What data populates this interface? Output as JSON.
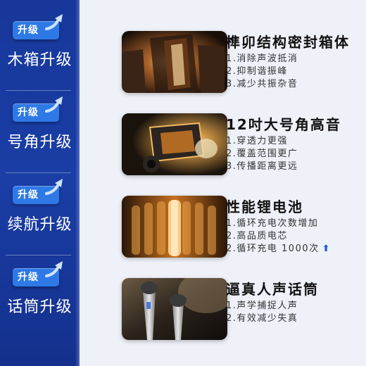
{
  "sidebar": {
    "items": [
      {
        "badge": "升级",
        "label": "木箱升级"
      },
      {
        "badge": "升级",
        "label": "号角升级"
      },
      {
        "badge": "升级",
        "label": "续航升级"
      },
      {
        "badge": "升级",
        "label": "话筒升级"
      }
    ]
  },
  "features": [
    {
      "title": "榫卯结构密封箱体",
      "points": [
        "1.消除声波抵消",
        "2.抑制谐振峰",
        "3.减少共振杂音"
      ]
    },
    {
      "title": "12吋大号角高音",
      "points": [
        "1.穿透力更强",
        "2.覆盖范围更广",
        "3.传播距离更远"
      ]
    },
    {
      "title": "性能锂电池",
      "points": [
        "1.循环充电次数增加",
        "2.高品质电芯",
        "2.循环充电 1000次"
      ],
      "up_icon": "arrow-up-icon"
    },
    {
      "title": "逼真人声话筒",
      "points": [
        "1.声学捕捉人声",
        "2.有效减少失真"
      ]
    }
  ],
  "colors": {
    "sidebar": "#17379a",
    "badge": "#2f79e6",
    "accent_arrow": "#1a5fd6",
    "background": "#eef1f8"
  }
}
